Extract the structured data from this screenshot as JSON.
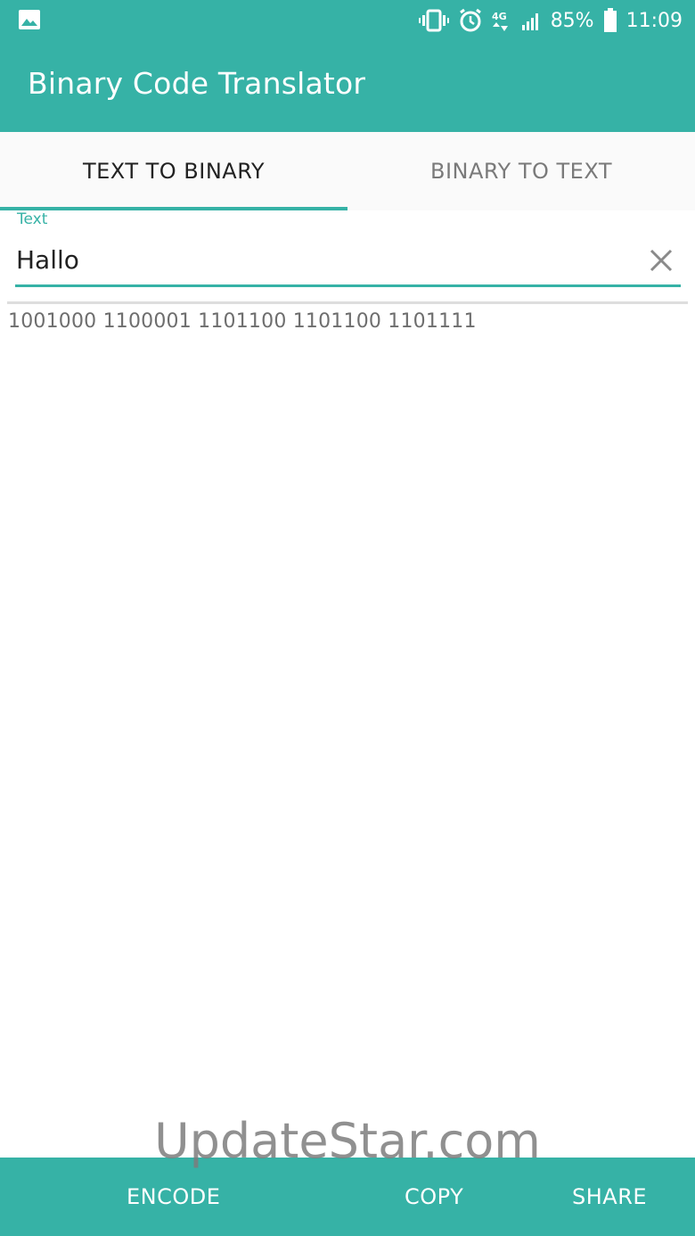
{
  "status_bar": {
    "left_icon": "image-icon",
    "battery_percent": "85%",
    "time": "11:09",
    "network": "4G"
  },
  "app": {
    "title": "Binary Code Translator",
    "accent_color": "#36b2a6"
  },
  "tabs": [
    {
      "label": "TEXT TO BINARY",
      "active": true
    },
    {
      "label": "BINARY TO TEXT",
      "active": false
    }
  ],
  "input": {
    "label": "Text",
    "value": "Hallo",
    "clear_icon": "close-icon"
  },
  "output": {
    "binary": "1001000 1100001 1101100 1101100 1101111"
  },
  "bottom_bar": {
    "encode_label": "ENCODE",
    "copy_label": "COPY",
    "share_label": "SHARE"
  },
  "watermark": "UpdateStar.com"
}
